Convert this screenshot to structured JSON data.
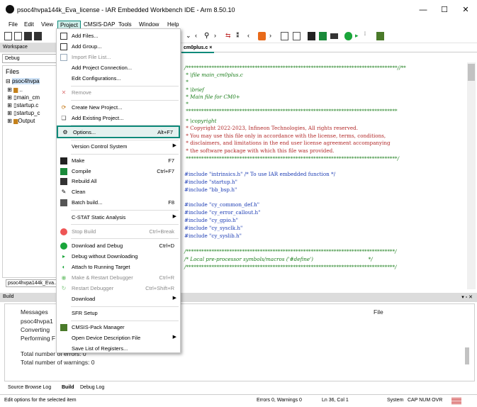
{
  "window": {
    "title": "psoc4hvpa144k_Eva_license - IAR Embedded Workbench IDE - Arm 8.50.10",
    "minimize": "—",
    "maximize": "☐",
    "close": "✕"
  },
  "menubar": {
    "items": [
      "File",
      "Edit",
      "View",
      "Project",
      "CMSIS-DAP",
      "Tools",
      "Window",
      "Help"
    ],
    "active": "Project"
  },
  "workspace": {
    "header": "Workspace",
    "config": "Debug",
    "files_header": "Files",
    "tree": [
      "psoc4hvpa",
      "..",
      "main_cm",
      "startup.c",
      "startup_c",
      "Output"
    ],
    "tab": "psoc4hvpa144k_Eva..."
  },
  "editor": {
    "tab": "cm0plus.c",
    "tab_close": "×",
    "lines": [
      "/***********************************************************************************//**",
      " * \\file main_cm0plus.c",
      " *",
      " * \\brief",
      " * Main file for CM0+",
      " *",
      " ***********************************************************************************",
      " * \\copyright",
      " * Copyright 2022-2023, Infineon Technologies, All rights reserved.",
      " * You may use this file only in accordance with the license, terms, conditions,",
      " * disclaimers, and limitations in the end user license agreement accompanying",
      " * the software package with which this file was provided.",
      " ***********************************************************************************/",
      "",
      "#include \"intrinsics.h\" /* To use IAR embedded function */",
      "#include \"startup.h\"",
      "#include \"bb_bsp.h\"",
      "",
      "#include \"cy_common_def.h\"",
      "#include \"cy_error_callout.h\"",
      "#include \"cy_gpio.h\"",
      "#include \"cy_sysclk.h\"",
      "#include \"cy_syslib.h\"",
      "",
      "",
      "/**********************************************************************************/",
      "/* Local pre-processor symbols/macros ('#define')                                  */",
      "/**********************************************************************************/"
    ]
  },
  "build": {
    "header": "Build",
    "col_messages": "Messages",
    "col_file": "File",
    "messages": [
      "psoc4hvpa1",
      "Converting",
      "Performing F",
      "Total number of errors: 0",
      "Total number of warnings: 0"
    ],
    "pin_icons": "▾ ▫ ✕"
  },
  "bottom_tabs": [
    "Source Browse Log",
    "Build",
    "Debug Log"
  ],
  "status": {
    "hint": "Edit options for the selected item",
    "errors": "Errors 0, Warnings 0",
    "position": "Ln 36, Col 1",
    "encoding": "System",
    "indicators": "CAP NUM OVR"
  },
  "project_menu": {
    "items": [
      {
        "label": "Add Files...",
        "shortcut": "",
        "icon": "add-files-icon"
      },
      {
        "label": "Add Group...",
        "shortcut": "",
        "icon": "add-group-icon"
      },
      {
        "label": "Import File List...",
        "shortcut": "",
        "icon": "import-list-icon",
        "disabled": true
      },
      {
        "label": "Add Project Connection...",
        "shortcut": ""
      },
      {
        "label": "Edit Configurations...",
        "shortcut": ""
      },
      {
        "label": "Remove",
        "shortcut": "",
        "icon": "remove-icon",
        "disabled": true
      },
      {
        "label": "Create New Project...",
        "shortcut": "",
        "icon": "new-project-icon"
      },
      {
        "label": "Add Existing Project...",
        "shortcut": "",
        "icon": "existing-project-icon"
      },
      {
        "label": "Options...",
        "shortcut": "Alt+F7",
        "icon": "gear-icon",
        "highlight": true
      },
      {
        "label": "Version Control System",
        "shortcut": "",
        "submenu": true
      },
      {
        "label": "Make",
        "shortcut": "F7",
        "icon": "make-icon"
      },
      {
        "label": "Compile",
        "shortcut": "Ctrl+F7",
        "icon": "compile-icon"
      },
      {
        "label": "Rebuild All",
        "shortcut": "",
        "icon": "rebuild-icon"
      },
      {
        "label": "Clean",
        "shortcut": "",
        "icon": "clean-icon"
      },
      {
        "label": "Batch build...",
        "shortcut": "F8",
        "icon": "batch-build-icon"
      },
      {
        "label": "C-STAT Static Analysis",
        "shortcut": "",
        "submenu": true
      },
      {
        "label": "Stop Build",
        "shortcut": "Ctrl+Break",
        "icon": "stop-icon",
        "disabled": true
      },
      {
        "label": "Download and Debug",
        "shortcut": "Ctrl+D",
        "icon": "debug-icon"
      },
      {
        "label": "Debug without Downloading",
        "shortcut": "",
        "icon": "debug-nodl-icon"
      },
      {
        "label": "Attach to Running Target",
        "shortcut": "",
        "icon": "attach-icon"
      },
      {
        "label": "Make & Restart Debugger",
        "shortcut": "Ctrl+R",
        "icon": "make-restart-icon",
        "disabled": true
      },
      {
        "label": "Restart Debugger",
        "shortcut": "Ctrl+Shift+R",
        "icon": "restart-icon",
        "disabled": true
      },
      {
        "label": "Download",
        "shortcut": "",
        "submenu": true
      },
      {
        "label": "SFR Setup",
        "shortcut": ""
      },
      {
        "label": "CMSIS-Pack Manager",
        "shortcut": "",
        "icon": "pack-icon"
      },
      {
        "label": "Open Device Description File",
        "shortcut": "",
        "submenu": true
      },
      {
        "label": "Save List of Registers...",
        "shortcut": ""
      }
    ]
  },
  "colors": {
    "accent": "#0e8a7a",
    "comment": "#1a7d1a",
    "include": "#1c3cb4"
  }
}
